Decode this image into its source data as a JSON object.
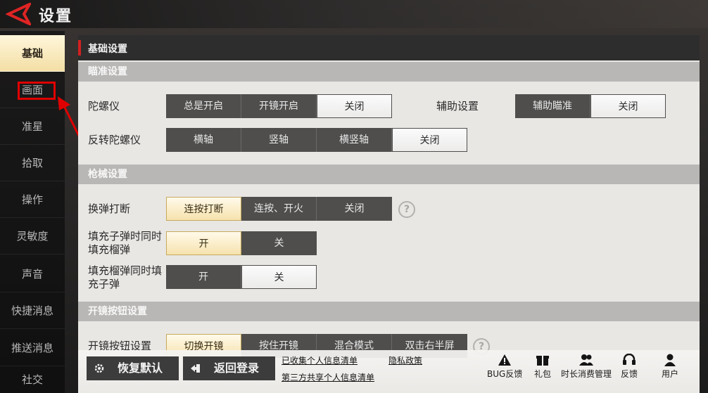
{
  "window": {
    "title": "设置"
  },
  "sidebar": {
    "items": [
      {
        "label": "基础"
      },
      {
        "label": "画面"
      },
      {
        "label": "准星"
      },
      {
        "label": "拾取"
      },
      {
        "label": "操作"
      },
      {
        "label": "灵敏度"
      },
      {
        "label": "声音"
      },
      {
        "label": "快捷消息"
      },
      {
        "label": "推送消息"
      },
      {
        "label": "社交"
      }
    ]
  },
  "panel": {
    "title": "基础设置"
  },
  "sections": {
    "aim": {
      "title": "瞄准设置",
      "gyro": {
        "label": "陀螺仪",
        "options": [
          "总是开启",
          "开镜开启",
          "关闭"
        ]
      },
      "assist": {
        "label": "辅助设置",
        "options": [
          "辅助瞄准",
          "关闭"
        ]
      },
      "reverse_gyro": {
        "label": "反转陀螺仪",
        "options": [
          "横轴",
          "竖轴",
          "横竖轴",
          "关闭"
        ]
      }
    },
    "weapon": {
      "title": "枪械设置",
      "reload_interrupt": {
        "label": "换弹打断",
        "options": [
          "连按打断",
          "连按、开火",
          "关闭"
        ]
      },
      "fill_bullet": {
        "label_line1": "填充子弹时同时",
        "label_line2": "填充榴弹",
        "options": [
          "开",
          "关"
        ]
      },
      "fill_grenade": {
        "label_line1": "填充榴弹同时填",
        "label_line2": "充子弹",
        "options": [
          "开",
          "关"
        ]
      }
    },
    "scope": {
      "title": "开镜按钮设置",
      "scope_button": {
        "label": "开镜按钮设置",
        "options": [
          "切换开镜",
          "按住开镜",
          "混合模式",
          "双击右半屏"
        ]
      }
    }
  },
  "bottom": {
    "restore_default": "恢复默认",
    "back_to_login": "返回登录",
    "links": {
      "collected_info": "已收集个人信息清单",
      "privacy_policy": "隐私政策",
      "third_party_info": "第三方共享个人信息清单"
    },
    "tools": {
      "bug_report": "BUG反馈",
      "gift": "礼包",
      "time_spending": "时长消费管理",
      "feedback": "反馈",
      "user": "用户"
    }
  },
  "colors": {
    "accent_red": "#d42020",
    "active_gold": "#f3dea4",
    "segment_dark": "#4f4e4d",
    "annotation_red": "#e00000"
  },
  "icons": [
    "back-arrow-icon",
    "question-icon",
    "gear-icon",
    "logout-icon",
    "warning-icon",
    "gift-icon",
    "people-icon",
    "headset-icon",
    "user-icon"
  ]
}
